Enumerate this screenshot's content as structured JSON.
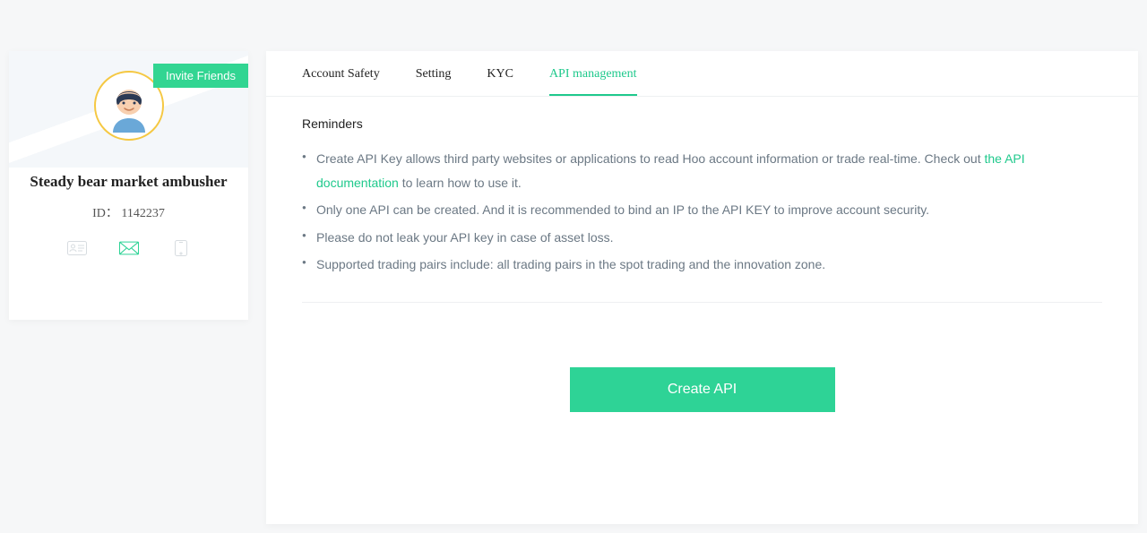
{
  "sidebar": {
    "invite_label": "Invite Friends",
    "username": "Steady bear market ambusher",
    "id_label": "ID：",
    "id_value": "1142237"
  },
  "tabs": [
    {
      "label": "Account Safety",
      "active": false
    },
    {
      "label": "Setting",
      "active": false
    },
    {
      "label": "KYC",
      "active": false
    },
    {
      "label": "API management",
      "active": true
    }
  ],
  "reminders": {
    "title": "Reminders",
    "item1_prefix": "Create API Key allows third party websites or applications to read Hoo account information or trade real-time. Check out ",
    "item1_link": "the API documentation",
    "item1_suffix": " to learn how to use it.",
    "item2": "Only one API can be created. And it is recommended to bind an IP to the API KEY to improve account security.",
    "item3": "Please do not leak your API key in case of asset loss.",
    "item4": "Supported trading pairs include: all trading pairs in the spot trading and the innovation zone."
  },
  "actions": {
    "create_api": "Create API"
  },
  "colors": {
    "accent": "#1fc98c",
    "button": "#2ed396"
  }
}
